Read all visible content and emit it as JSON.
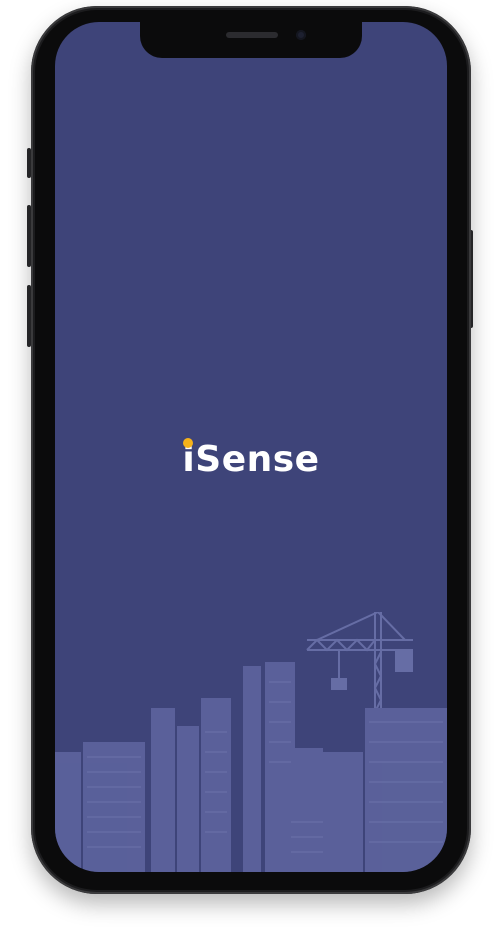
{
  "app": {
    "name": "iSense",
    "screen": "splash"
  },
  "logo": {
    "text": "iSense",
    "accent_color": "#f5b21a",
    "text_color": "#ffffff"
  },
  "theme": {
    "background": "#3e4479",
    "skyline_color": "#5f66a0"
  },
  "illustration": {
    "subject": "city-skyline-with-crane-icon"
  }
}
